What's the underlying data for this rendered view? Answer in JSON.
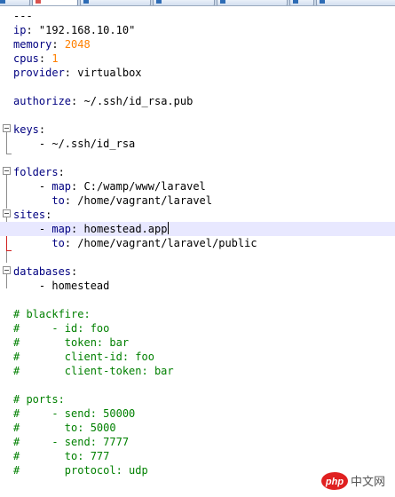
{
  "colors": {
    "key": "#000080",
    "number": "#ff8000",
    "comment": "#008000",
    "fold_marker": "#8c8c8c",
    "active_fold": "#d02020",
    "current_line": "#e8e8ff"
  },
  "watermark": {
    "text": "php 中文网"
  },
  "lines": [
    {
      "text": "---"
    },
    {
      "key": "ip",
      "value": "\"192.168.10.10\""
    },
    {
      "key": "memory",
      "number": "2048"
    },
    {
      "key": "cpus",
      "number": "1"
    },
    {
      "key": "provider",
      "value": "virtualbox"
    },
    {
      "text": ""
    },
    {
      "key": "authorize",
      "value": "~/.ssh/id_rsa.pub"
    },
    {
      "text": ""
    },
    {
      "key": "keys",
      "value": ""
    },
    {
      "text": "    - ~/.ssh/id_rsa"
    },
    {
      "text": ""
    },
    {
      "key": "folders",
      "value": ""
    },
    {
      "indent": "    - ",
      "key": "map",
      "value": "C:/wamp/www/laravel"
    },
    {
      "indent": "      ",
      "key": "to",
      "value": "/home/vagrant/laravel"
    },
    {
      "key": "sites",
      "value": ""
    },
    {
      "indent": "    - ",
      "key": "map",
      "value": "homestead.app"
    },
    {
      "indent": "      ",
      "key": "to",
      "value": "/home/vagrant/laravel/public"
    },
    {
      "text": ""
    },
    {
      "key": "databases",
      "value": ""
    },
    {
      "text": "    - homestead"
    },
    {
      "text": ""
    },
    {
      "comment": "# blackfire:"
    },
    {
      "comment": "#     - id: foo"
    },
    {
      "comment": "#       token: bar"
    },
    {
      "comment": "#       client-id: foo"
    },
    {
      "comment": "#       client-token: bar"
    },
    {
      "text": ""
    },
    {
      "comment": "# ports:"
    },
    {
      "comment": "#     - send: 50000"
    },
    {
      "comment": "#       to: 5000"
    },
    {
      "comment": "#     - send: 7777"
    },
    {
      "comment": "#       to: 777"
    },
    {
      "comment": "#       protocol: udp"
    }
  ]
}
